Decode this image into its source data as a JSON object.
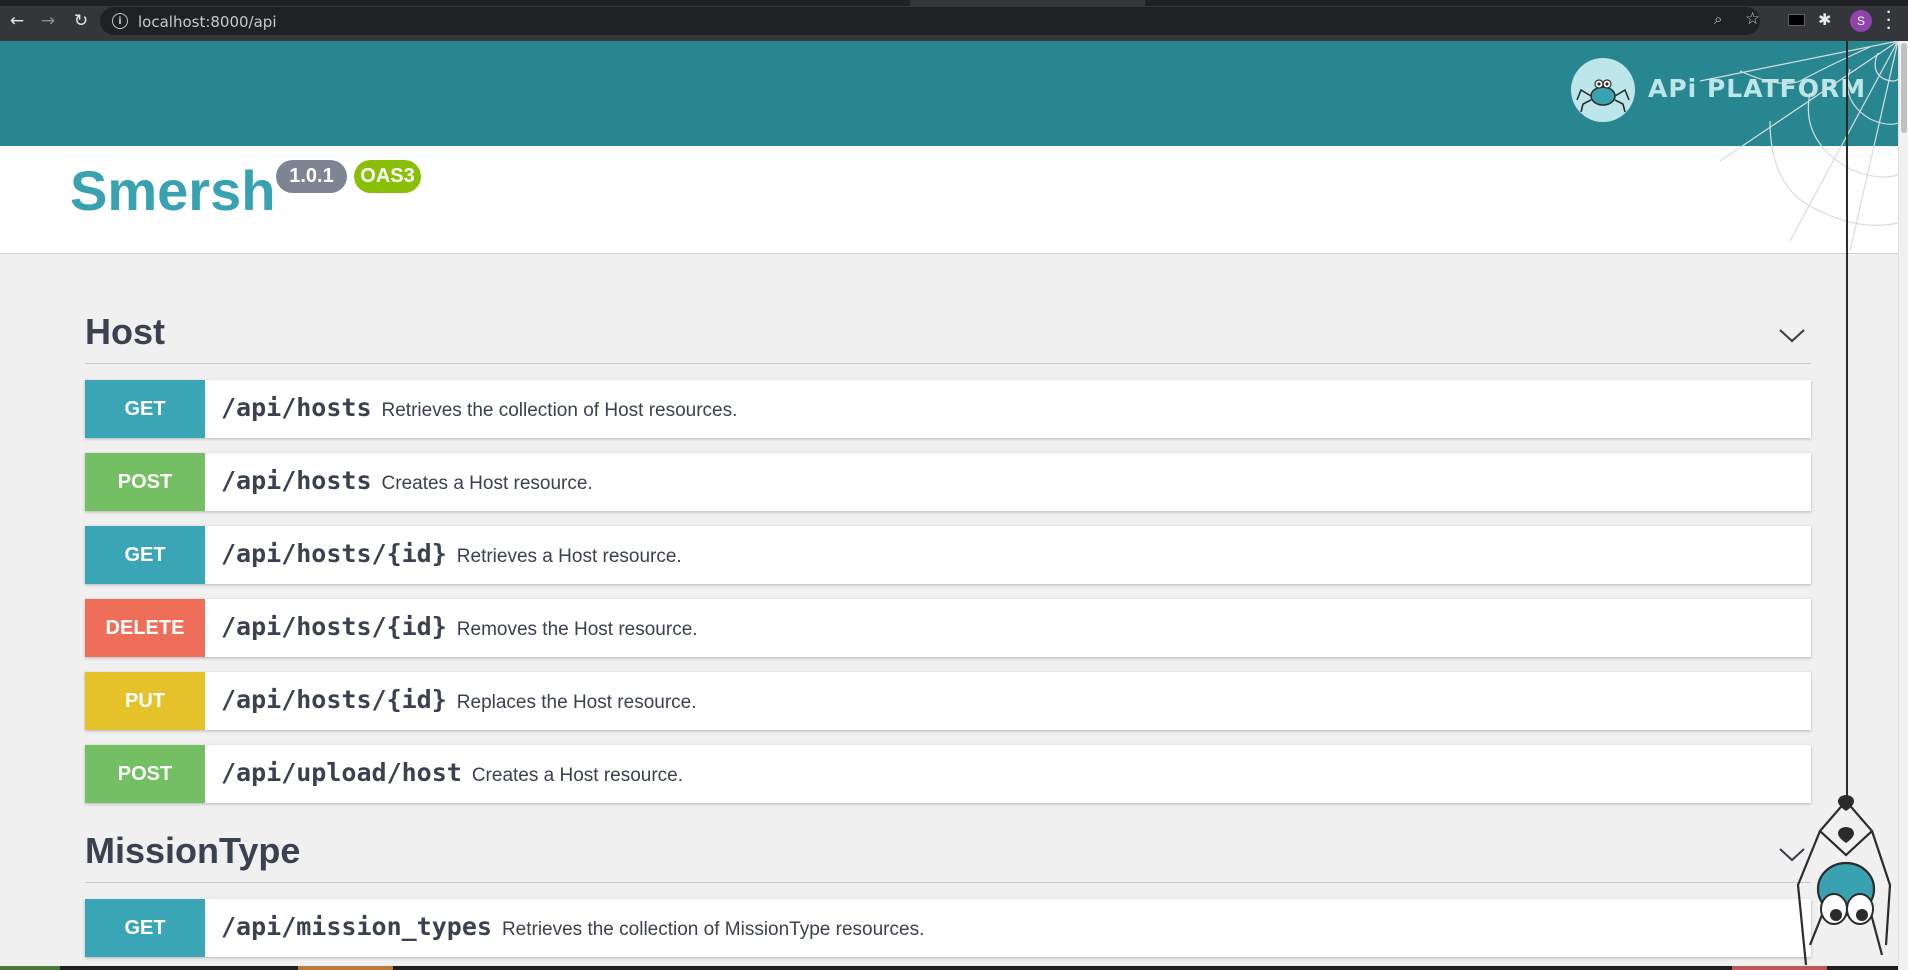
{
  "browser": {
    "url": "localhost:8000/api",
    "profile_initial": "S"
  },
  "header": {
    "logo_text": "APi PLATFORM"
  },
  "info": {
    "title": "Smersh",
    "version": "1.0.1",
    "spec": "OAS3"
  },
  "sections": [
    {
      "name": "Host",
      "operations": [
        {
          "method": "GET",
          "path": "/api/hosts",
          "description": "Retrieves the collection of Host resources."
        },
        {
          "method": "POST",
          "path": "/api/hosts",
          "description": "Creates a Host resource."
        },
        {
          "method": "GET",
          "path": "/api/hosts/{id}",
          "description": "Retrieves a Host resource."
        },
        {
          "method": "DELETE",
          "path": "/api/hosts/{id}",
          "description": "Removes the Host resource."
        },
        {
          "method": "PUT",
          "path": "/api/hosts/{id}",
          "description": "Replaces the Host resource."
        },
        {
          "method": "POST",
          "path": "/api/upload/host",
          "description": "Creates a Host resource."
        }
      ]
    },
    {
      "name": "MissionType",
      "operations": [
        {
          "method": "GET",
          "path": "/api/mission_types",
          "description": "Retrieves the collection of MissionType resources."
        }
      ]
    }
  ],
  "colors": {
    "header": "#288690",
    "title": "#38a2b0",
    "get": "#3aa5b4",
    "post": "#74bf63",
    "delete": "#ef6e5a",
    "put": "#e5c12a",
    "version_badge": "#7d8492",
    "oas_badge": "#89bf04"
  }
}
